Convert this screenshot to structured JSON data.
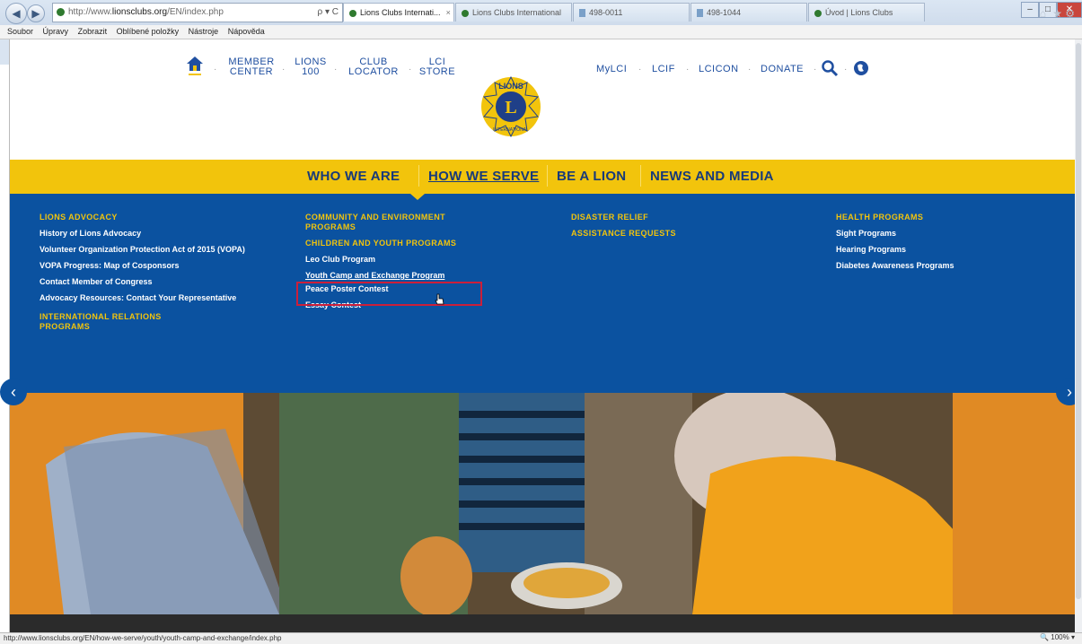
{
  "browser": {
    "address_prefix": "http://www.",
    "address_domain": "lionsclubs.org",
    "address_path": "/EN/index.php",
    "address_tools": "ρ ▾ C",
    "tabs": [
      "Lions Clubs Internati...",
      "Lions Clubs International",
      "498-0011",
      "498-1044",
      "Úvod | Lions Clubs"
    ],
    "tab_close": "×",
    "menu": [
      "Soubor",
      "Úpravy",
      "Zobrazit",
      "Oblíbené položky",
      "Nástroje",
      "Nápověda"
    ],
    "status_url": "http://www.lionsclubs.org/EN/how-we-serve/youth/youth-camp-and-exchange/index.php",
    "zoom": "100%"
  },
  "top_nav": {
    "member_center": "MEMBER\nCENTER",
    "lions_100": "LIONS\n100",
    "club_locator": "CLUB\nLOCATOR",
    "lci_store": "LCI\nSTORE",
    "mylci": "MyLCI",
    "lcif": "LCIF",
    "lcicon": "LCICON",
    "donate": "DONATE",
    "sep": "·"
  },
  "logo": {
    "top_text": "LIONS",
    "letter": "L",
    "bottom_text": "INTERNATIONAL"
  },
  "main_nav": [
    "WHO WE ARE",
    "HOW WE SERVE",
    "BE A LION",
    "NEWS AND MEDIA"
  ],
  "mega": {
    "col1": {
      "heading": "LIONS ADVOCACY",
      "links": [
        "History of Lions Advocacy",
        "Volunteer Organization Protection Act of 2015 (VOPA)",
        "VOPA Progress: Map of Cosponsors",
        "Contact Member of Congress",
        "Advocacy Resources: Contact Your Representative"
      ],
      "heading2": "INTERNATIONAL RELATIONS PROGRAMS"
    },
    "col2": {
      "heading": "COMMUNITY AND ENVIRONMENT PROGRAMS",
      "heading2": "CHILDREN AND YOUTH PROGRAMS",
      "links": [
        "Leo Club Program",
        "Youth Camp and Exchange Program",
        "Peace Poster Contest",
        "Essay Contest"
      ]
    },
    "col3": {
      "heading": "DISASTER RELIEF",
      "heading2": "ASSISTANCE REQUESTS"
    },
    "col4": {
      "heading": "HEALTH PROGRAMS",
      "links": [
        "Sight Programs",
        "Hearing Programs",
        "Diabetes Awareness Programs"
      ]
    }
  },
  "hero": {
    "prev": "‹",
    "next": "›"
  },
  "colors": {
    "brand_blue": "#0b52a0",
    "brand_yellow": "#f2c40c",
    "highlight": "#cc1f3a"
  }
}
